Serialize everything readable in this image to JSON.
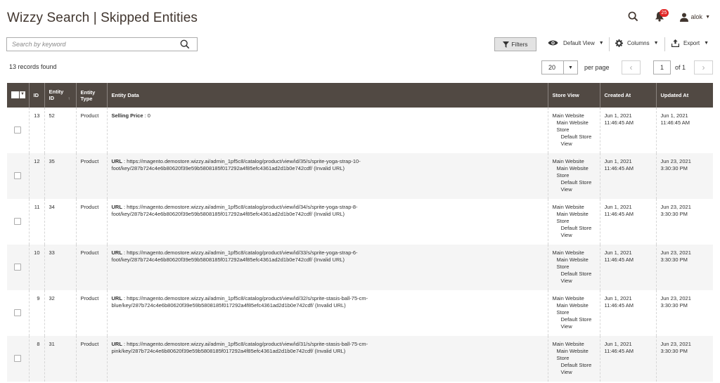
{
  "header": {
    "title": "Wizzy Search | Skipped Entities",
    "notification_count": "25",
    "user": "alok"
  },
  "toolbar": {
    "search_placeholder": "Search by keyword",
    "filters_label": "Filters",
    "view_label": "Default View",
    "columns_label": "Columns",
    "export_label": "Export"
  },
  "grid": {
    "records_found": "13 records found",
    "per_page_value": "20",
    "per_page_label": "per page",
    "current_page": "1",
    "page_of": "of 1",
    "columns": [
      "ID",
      "Entity ID",
      "Entity Type",
      "Entity Data",
      "Store View",
      "Created At",
      "Updated At"
    ],
    "rows": [
      {
        "id": "13",
        "entity_id": "52",
        "type": "Product",
        "data_key": "Selling Price",
        "data_value": " : 0",
        "sv1": "Main Website",
        "sv2": "Main Website Store",
        "sv3": "Default Store View",
        "created": "Jun 1, 2021 11:46:45 AM",
        "updated": "Jun 1, 2021 11:46:45 AM"
      },
      {
        "id": "12",
        "entity_id": "35",
        "type": "Product",
        "data_key": "URL",
        "data_value": " : https://magento.demostore.wizzy.ai/admin_1pf5c8/catalog/product/view/id/35/s/sprite-yoga-strap-10-foot/key/287b724c4e6b80620f39e59b5808185f017292a4f85efc4361ad2d1b0e742cdf/ (Invalid URL)",
        "sv1": "Main Website",
        "sv2": "Main Website Store",
        "sv3": "Default Store View",
        "created": "Jun 1, 2021 11:46:45 AM",
        "updated": "Jun 23, 2021 3:30:30 PM"
      },
      {
        "id": "11",
        "entity_id": "34",
        "type": "Product",
        "data_key": "URL",
        "data_value": " : https://magento.demostore.wizzy.ai/admin_1pf5c8/catalog/product/view/id/34/s/sprite-yoga-strap-8-foot/key/287b724c4e6b80620f39e59b5808185f017292a4f85efc4361ad2d1b0e742cdf/ (Invalid URL)",
        "sv1": "Main Website",
        "sv2": "Main Website Store",
        "sv3": "Default Store View",
        "created": "Jun 1, 2021 11:46:45 AM",
        "updated": "Jun 23, 2021 3:30:30 PM"
      },
      {
        "id": "10",
        "entity_id": "33",
        "type": "Product",
        "data_key": "URL",
        "data_value": " : https://magento.demostore.wizzy.ai/admin_1pf5c8/catalog/product/view/id/33/s/sprite-yoga-strap-6-foot/key/287b724c4e6b80620f39e59b5808185f017292a4f85efc4361ad2d1b0e742cdf/ (Invalid URL)",
        "sv1": "Main Website",
        "sv2": "Main Website Store",
        "sv3": "Default Store View",
        "created": "Jun 1, 2021 11:46:45 AM",
        "updated": "Jun 23, 2021 3:30:30 PM"
      },
      {
        "id": "9",
        "entity_id": "32",
        "type": "Product",
        "data_key": "URL",
        "data_value": " : https://magento.demostore.wizzy.ai/admin_1pf5c8/catalog/product/view/id/32/s/sprite-stasis-ball-75-cm-blue/key/287b724c4e6b80620f39e59b5808185f017292a4f85efc4361ad2d1b0e742cdf/ (Invalid URL)",
        "sv1": "Main Website",
        "sv2": "Main Website Store",
        "sv3": "Default Store View",
        "created": "Jun 1, 2021 11:46:45 AM",
        "updated": "Jun 23, 2021 3:30:30 PM"
      },
      {
        "id": "8",
        "entity_id": "31",
        "type": "Product",
        "data_key": "URL",
        "data_value": " : https://magento.demostore.wizzy.ai/admin_1pf5c8/catalog/product/view/id/31/s/sprite-stasis-ball-75-cm-pink/key/287b724c4e6b80620f39e59b5808185f017292a4f85efc4361ad2d1b0e742cdf/ (Invalid URL)",
        "sv1": "Main Website",
        "sv2": "Main Website Store",
        "sv3": "Default Store View",
        "created": "Jun 1, 2021 11:46:45 AM",
        "updated": "Jun 23, 2021 3:30:30 PM"
      }
    ]
  },
  "icons": {
    "header_bg": "#514943",
    "badge_color": "#e22626"
  }
}
